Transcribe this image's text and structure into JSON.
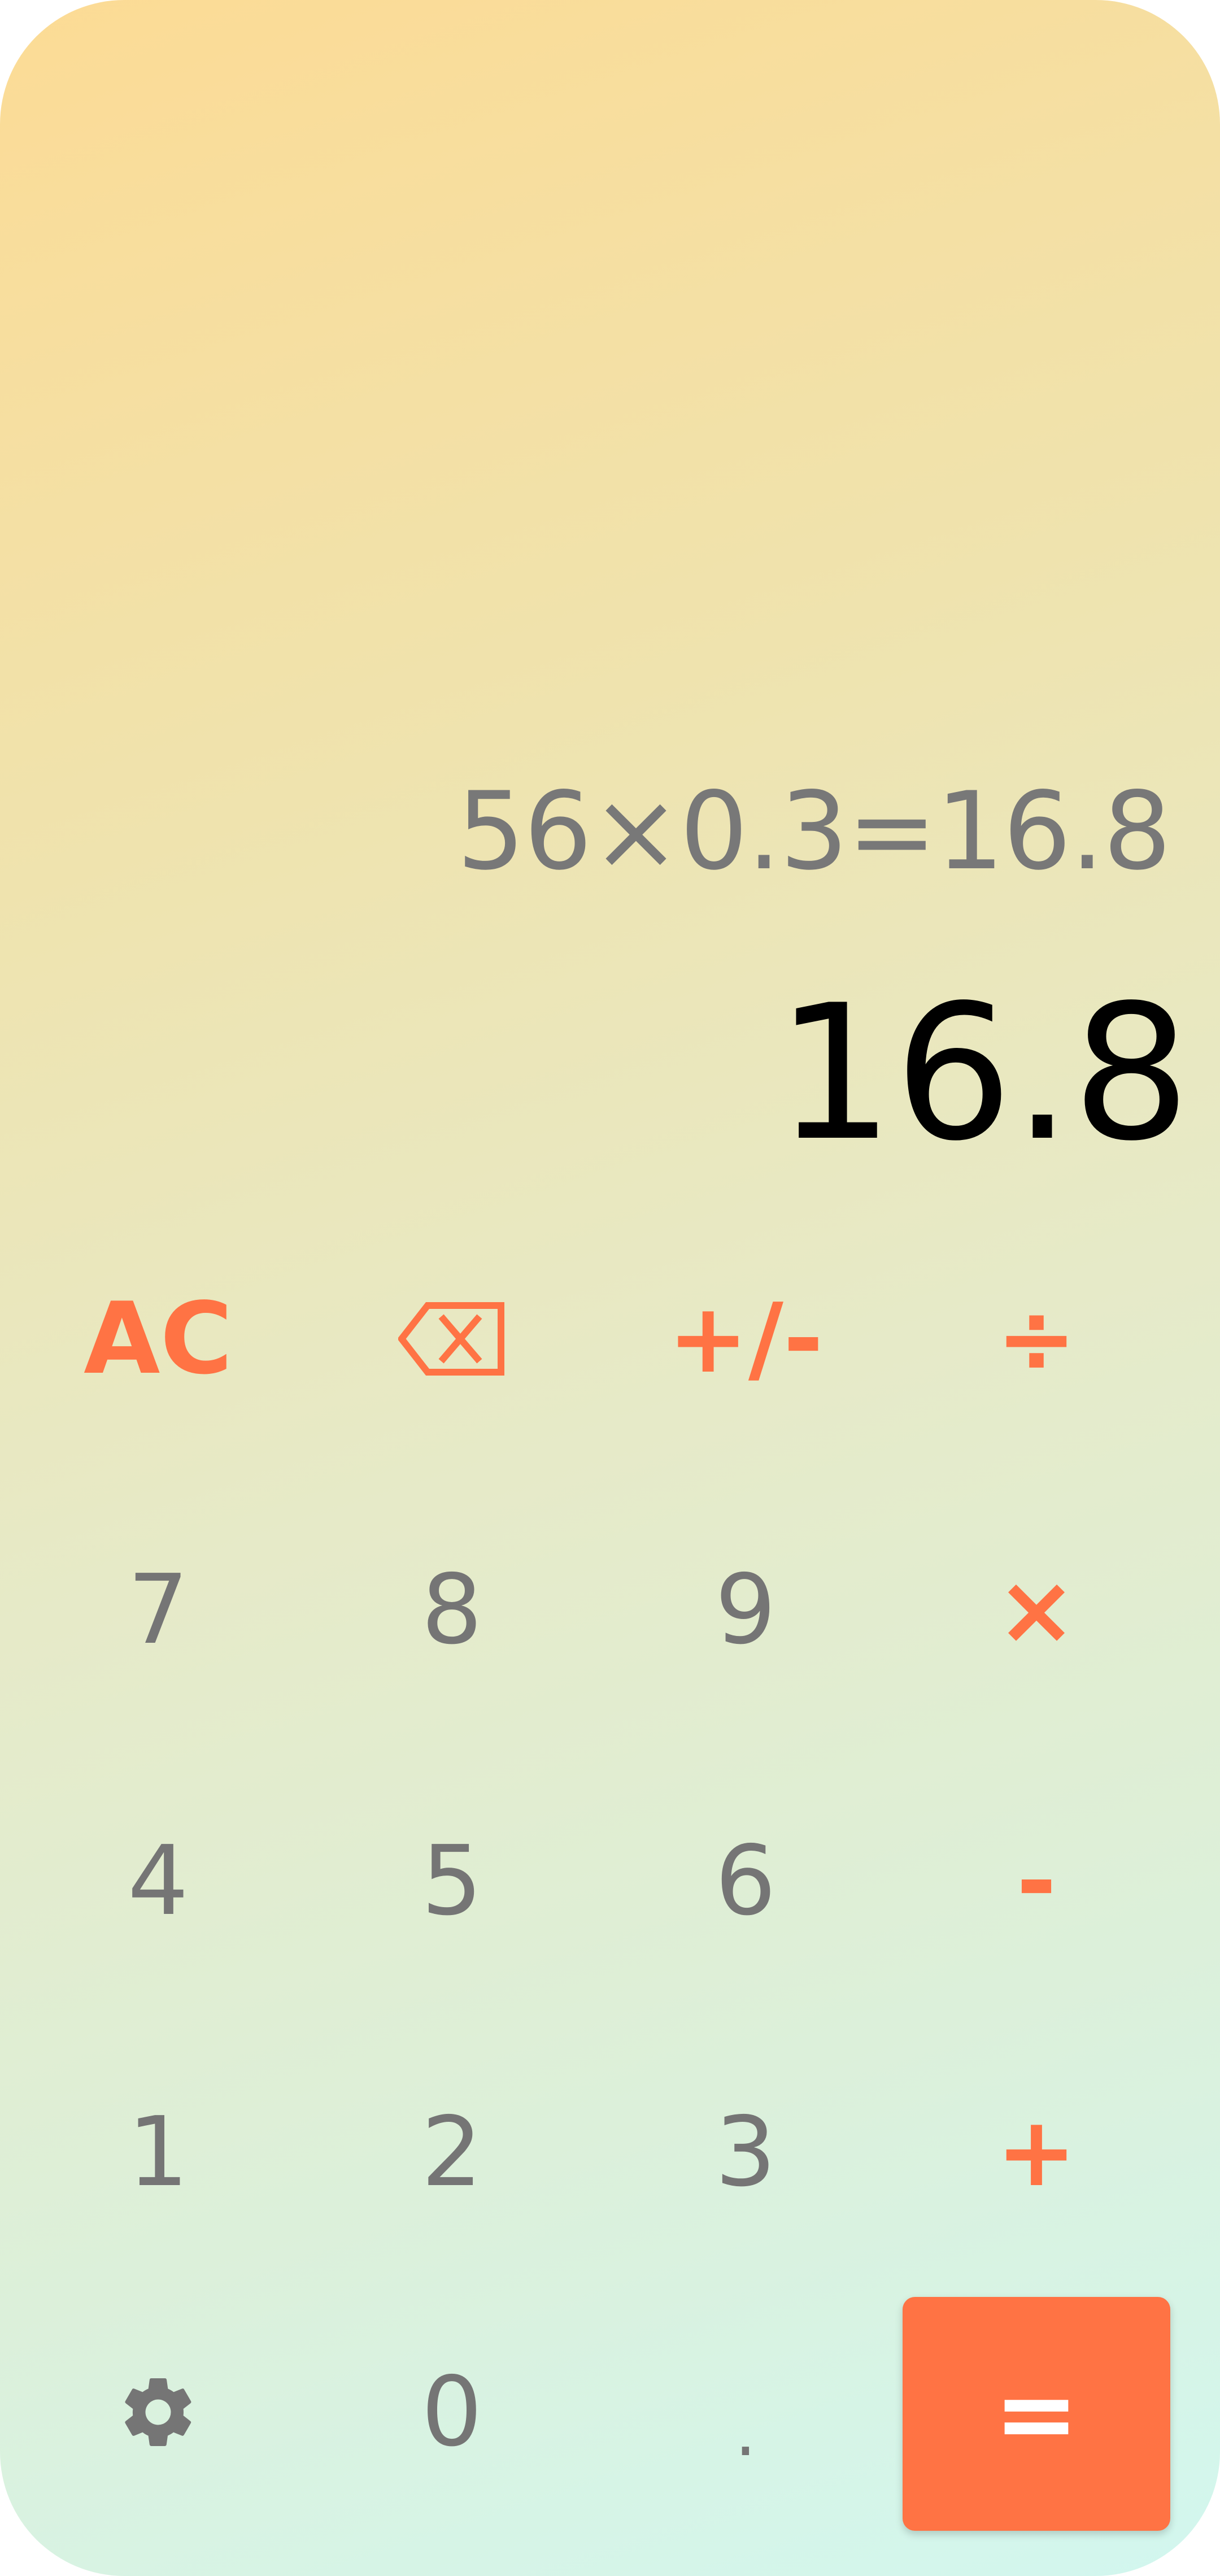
{
  "display": {
    "expression": "56×0.3=16.8",
    "result": "16.8"
  },
  "keys": {
    "ac": "AC",
    "backspace_icon": "backspace-icon",
    "sign": "+/-",
    "divide": "÷",
    "seven": "7",
    "eight": "8",
    "nine": "9",
    "multiply": "×",
    "four": "4",
    "five": "5",
    "six": "6",
    "minus": "-",
    "one": "1",
    "two": "2",
    "three": "3",
    "plus": "+",
    "settings_icon": "gear-icon",
    "zero": "0",
    "dot": ".",
    "equals": "="
  },
  "colors": {
    "accent": "#ff7344",
    "digit": "#757575",
    "expression": "#787878",
    "result": "#000000",
    "gradient_top": "#fcdb95",
    "gradient_bottom": "#d2f7ef"
  }
}
